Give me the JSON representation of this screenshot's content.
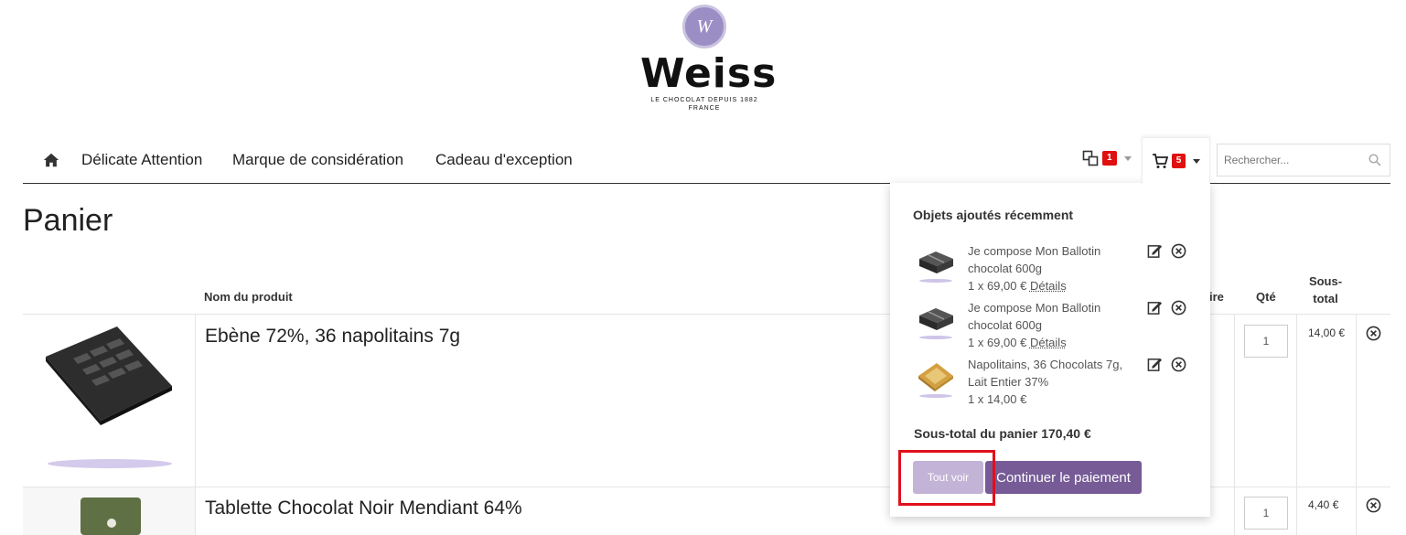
{
  "brand": {
    "monogram": "W",
    "name": "Weiss",
    "tagline_1": "LE CHOCOLAT DEPUIS 1882",
    "tagline_2": "FRANCE"
  },
  "nav": {
    "links": [
      "Délicate Attention",
      "Marque de considération",
      "Cadeau d'exception"
    ],
    "compare_count": "1",
    "cart_count": "5",
    "search_placeholder": "Rechercher..."
  },
  "page": {
    "title": "Panier"
  },
  "table": {
    "headers": {
      "name": "Nom du produit",
      "unit_price_suffix": "ire",
      "qty": "Qté",
      "subtotal_line1": "Sous-",
      "subtotal_line2": "total"
    },
    "rows": [
      {
        "name": "Ebène 72%, 36 napolitains 7g",
        "qty": "1",
        "subtotal": "14,00 €"
      },
      {
        "name": "Tablette Chocolat Noir Mendiant 64%",
        "qty": "1",
        "subtotal": "4,40 €"
      }
    ]
  },
  "minicart": {
    "title": "Objets ajoutés récemment",
    "items": [
      {
        "name_l1": "Je compose Mon Ballotin",
        "name_l2": "chocolat 600g",
        "price": "1 x 69,00 €",
        "details": "Détails"
      },
      {
        "name_l1": "Je compose Mon Ballotin",
        "name_l2": "chocolat 600g",
        "price": "1 x 69,00 €",
        "details": "Détails"
      },
      {
        "name_l1": "Napolitains, 36 Chocolats 7g,",
        "name_l2": "Lait Entier 37%",
        "price": "1 x 14,00 €",
        "details": ""
      }
    ],
    "subtotal": "Sous-total du panier 170,40 €",
    "view_all": "Tout voir",
    "checkout": "Continuer le paiement"
  },
  "colors": {
    "accent": "#765b96",
    "accent_light": "#c3b3d6",
    "badge": "#e01010",
    "highlight": "#e0101c"
  }
}
